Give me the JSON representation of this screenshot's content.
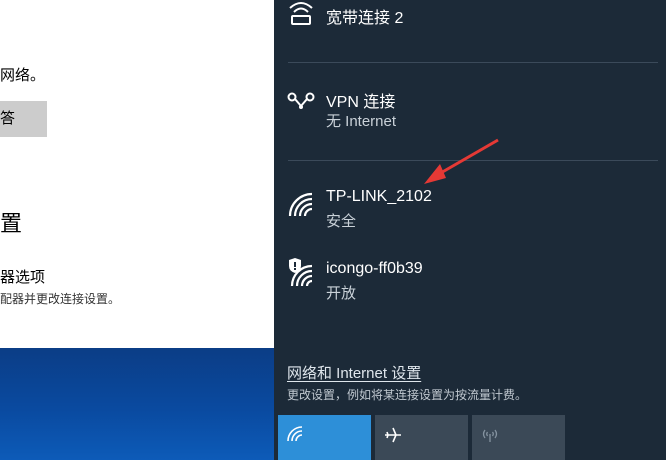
{
  "settings_window": {
    "line1": "网络。",
    "button_label": "答",
    "section_heading": "置",
    "option_title": "器选项",
    "option_desc": "配器并更改连接设置。"
  },
  "flyout": {
    "networks": [
      {
        "name": "宽带连接 2",
        "status": ""
      },
      {
        "name": "VPN 连接",
        "status": "无 Internet"
      },
      {
        "name": "TP-LINK_2102",
        "status": "安全"
      },
      {
        "name": "icongo-ff0b39",
        "status": "开放"
      }
    ],
    "settings_link": "网络和 Internet 设置",
    "settings_desc": "更改设置，例如将某连接设置为按流量计费。",
    "quick_actions": [
      {
        "icon": "wifi-icon",
        "active": true
      },
      {
        "icon": "airplane-icon",
        "active": false
      },
      {
        "icon": "mobile-hotspot-icon",
        "active": false
      }
    ]
  },
  "colors": {
    "flyout_bg": "#1c2a38",
    "accent": "#2d8fd8",
    "tile_inactive": "#3b4957",
    "annotation_arrow": "#e53935"
  }
}
